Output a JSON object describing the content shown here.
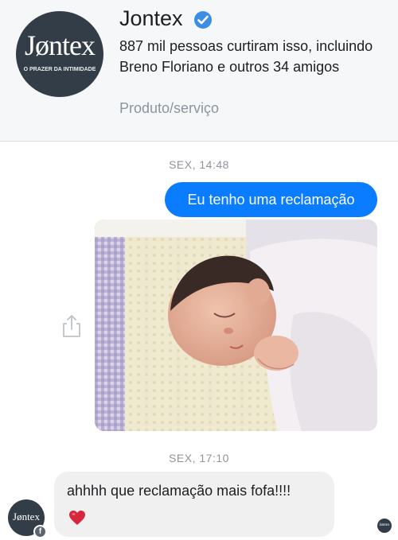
{
  "page": {
    "logo_text": "Jøntex",
    "logo_tagline": "O PRAZER DA INTIMIDADE",
    "name": "Jontex",
    "verified_icon": "verified-check-icon",
    "likes_text": "887 mil pessoas curtiram isso, incluindo Breno Floriano e outros 34 amigos",
    "category": "Produto/serviço"
  },
  "conversation": {
    "timestamp_1": "SEX, 14:48",
    "outgoing_message": "Eu tenho uma reclamação",
    "photo_description_icon": "baby-photo",
    "share_icon": "share-icon",
    "timestamp_2": "SEX, 17:10",
    "incoming_message": "ahhhh que reclamação mais fofa!!!!",
    "reaction_icon": "red-heart-icon",
    "sender_avatar_text": "Jøntex",
    "seen_avatar_text": "Jøntex"
  },
  "colors": {
    "outgoing_bubble": "#0a7cff",
    "incoming_bubble": "#f1f0f0",
    "logo_bg": "#333d47",
    "verified": "#3b8ee4",
    "heart": "#d7263d"
  }
}
